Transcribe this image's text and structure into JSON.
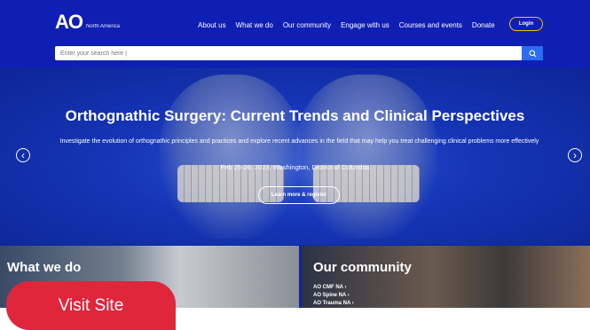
{
  "header": {
    "logo": "AO",
    "logo_sub": "North America",
    "nav": [
      "About us",
      "What we do",
      "Our community",
      "Engage with us",
      "Courses and events",
      "Donate"
    ],
    "login": "Login",
    "search_placeholder": "Enter your search here |"
  },
  "hero": {
    "title": "Orthognathic Surgery: Current Trends and Clinical Perspectives",
    "description": "Investigate the evolution of orthognathic principles and practices and explore recent advances in the field that may help you treat challenging clinical problems more effectively",
    "date": "Feb 25-26, 2023, Washington, District of Columbia",
    "cta": "Learn more & register",
    "prev_icon": "‹",
    "next_icon": "›"
  },
  "cards": {
    "what_we_do": {
      "title": "What we do"
    },
    "community": {
      "title": "Our community",
      "links": [
        "AO CMF NA ›",
        "AO Spine NA ›",
        "AO Trauma NA ›"
      ]
    }
  },
  "visit_button": "Visit Site",
  "icons": {
    "search": "search-icon",
    "prev": "chevron-left-icon",
    "next": "chevron-right-icon"
  },
  "colors": {
    "header": "#0f1fb4",
    "accent": "#f2c400",
    "search_button": "#2a6cf2",
    "visit": "#e0263b"
  }
}
